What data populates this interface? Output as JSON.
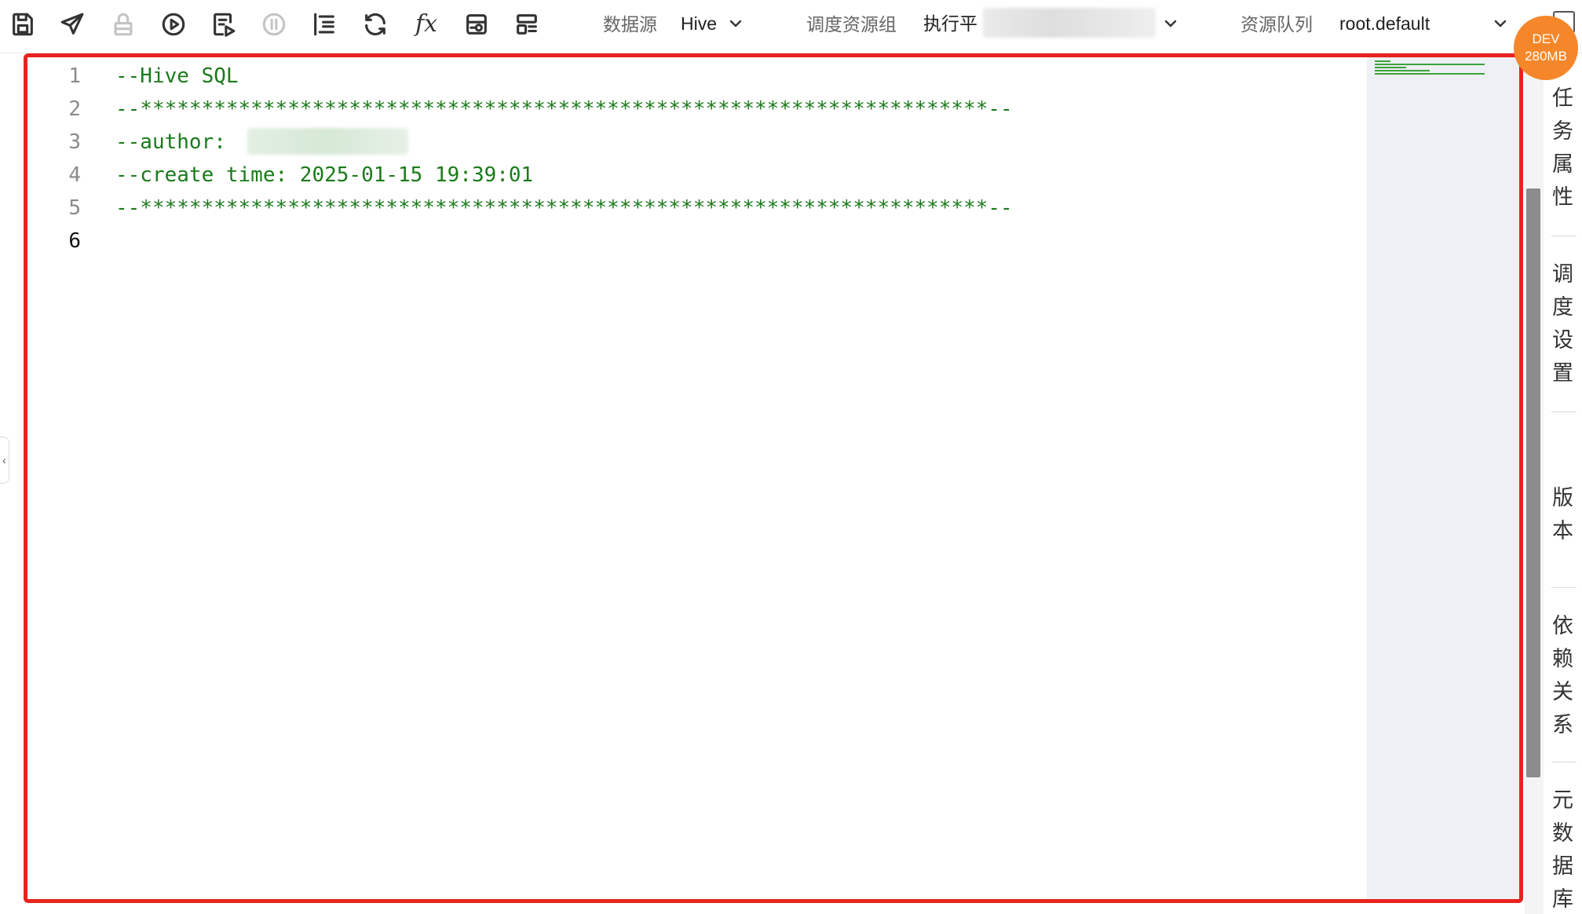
{
  "toolbar": {
    "buttons": [
      {
        "name": "save",
        "icon": "save-icon"
      },
      {
        "name": "submit",
        "icon": "send-icon"
      },
      {
        "name": "lock",
        "icon": "lock-icon"
      },
      {
        "name": "run",
        "icon": "play-icon"
      },
      {
        "name": "run-with-params",
        "icon": "run-params-icon"
      },
      {
        "name": "stop",
        "icon": "pause-icon"
      },
      {
        "name": "format",
        "icon": "format-icon"
      },
      {
        "name": "refresh",
        "icon": "refresh-icon"
      },
      {
        "name": "function",
        "icon": "function-icon"
      },
      {
        "name": "preview",
        "icon": "preview-icon"
      },
      {
        "name": "layout",
        "icon": "layout-icon"
      }
    ],
    "datasource_label": "数据源",
    "datasource_value": "Hive",
    "resource_group_label": "调度资源组",
    "resource_group_value": "执行平",
    "queue_label": "资源队列",
    "queue_value": "root.default",
    "fx_glyph": "fx"
  },
  "badge": {
    "env": "DEV",
    "memory": "280MB"
  },
  "editor": {
    "lines": [
      {
        "num": "1",
        "text": "--Hive SQL"
      },
      {
        "num": "2",
        "text": "--*********************************************************************--"
      },
      {
        "num": "3",
        "text": "--author: "
      },
      {
        "num": "4",
        "text": "--create time: 2025-01-15 19:39:01"
      },
      {
        "num": "5",
        "text": "--*********************************************************************--"
      },
      {
        "num": "6",
        "text": ""
      }
    ],
    "active_line": "6",
    "code_color": "#1a7a1a",
    "border_color": "#e8231e"
  },
  "side_panel": {
    "tabs": [
      {
        "chars": [
          "任",
          "务",
          "属",
          "性"
        ]
      },
      {
        "chars": [
          "调",
          "度",
          "设",
          "置"
        ]
      },
      {
        "chars": [
          "版",
          "本"
        ]
      },
      {
        "chars": [
          "依",
          "赖",
          "关",
          "系"
        ]
      },
      {
        "chars": [
          "元",
          "数",
          "据",
          "库"
        ]
      }
    ]
  },
  "collapse_glyph": "‹"
}
